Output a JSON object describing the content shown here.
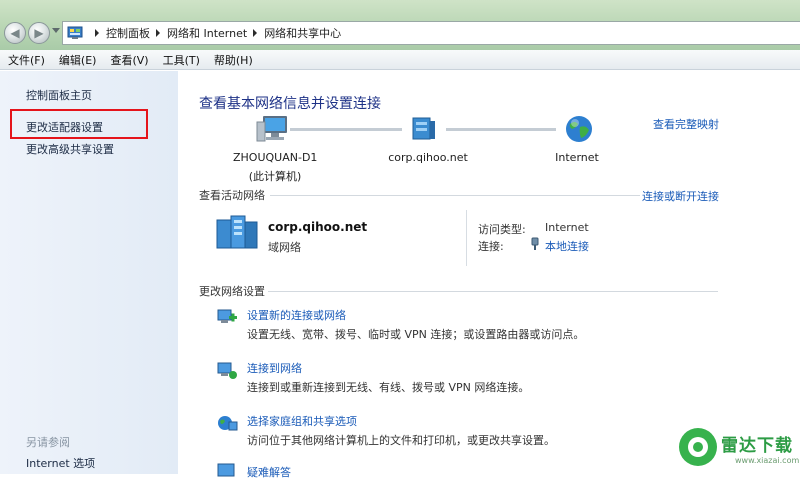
{
  "address_bar": {
    "crumbs": [
      "控制面板",
      "网络和 Internet",
      "网络和共享中心"
    ]
  },
  "menu": [
    "文件(F)",
    "编辑(E)",
    "查看(V)",
    "工具(T)",
    "帮助(H)"
  ],
  "sidebar": {
    "items": [
      "控制面板主页",
      "更改适配器设置",
      "更改高级共享设置"
    ],
    "see_also_label": "另请参阅",
    "see_also_items": [
      "Internet 选项"
    ]
  },
  "main": {
    "title": "查看基本网络信息并设置连接",
    "full_map_link": "查看完整映射",
    "nodes": [
      {
        "name": "ZHOUQUAN-D1",
        "sub": "(此计算机)",
        "icon": "computer-icon"
      },
      {
        "name": "corp.qihoo.net",
        "icon": "network-icon"
      },
      {
        "name": "Internet",
        "icon": "globe-icon"
      }
    ],
    "active_networks": {
      "heading": "查看活动网络",
      "connect_link": "连接或断开连接",
      "network_name": "corp.qihoo.net",
      "network_type": "域网络",
      "access_type_label": "访问类型:",
      "access_type_value": "Internet",
      "connection_label": "连接:",
      "connection_value": "本地连接"
    },
    "change_settings": {
      "heading": "更改网络设置",
      "tasks": [
        {
          "title": "设置新的连接或网络",
          "desc": "设置无线、宽带、拨号、临时或 VPN 连接；或设置路由器或访问点。",
          "icon": "new-connection-icon"
        },
        {
          "title": "连接到网络",
          "desc": "连接到或重新连接到无线、有线、拨号或 VPN 网络连接。",
          "icon": "connect-network-icon"
        },
        {
          "title": "选择家庭组和共享选项",
          "desc": "访问位于其他网络计算机上的文件和打印机，或更改共享设置。",
          "icon": "homegroup-icon"
        },
        {
          "title": "疑难解答",
          "icon": "troubleshoot-icon"
        }
      ]
    }
  },
  "watermark": {
    "name": "雷达下载",
    "url": "www.xiazai.com"
  },
  "colors": {
    "link": "#1a5bb8",
    "title": "#1e3287",
    "highlight": "#e5141b",
    "sidebar_bg": "#e2ebf6"
  }
}
